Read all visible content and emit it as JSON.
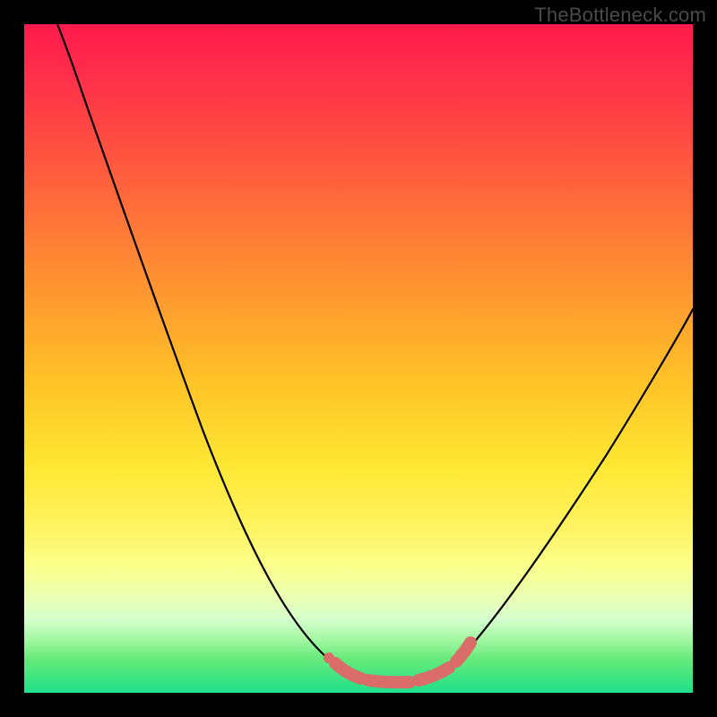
{
  "watermark": "TheBottleneck.com",
  "chart_data": {
    "type": "line",
    "title": "",
    "xlabel": "",
    "ylabel": "",
    "xlim": [
      0,
      100
    ],
    "ylim": [
      0,
      100
    ],
    "grid": false,
    "series": [
      {
        "name": "curve",
        "x": [
          5,
          8,
          12,
          16,
          20,
          24,
          28,
          32,
          36,
          40,
          44,
          48,
          51,
          53,
          56,
          59,
          62,
          65,
          68,
          72,
          76,
          80,
          84,
          88,
          92,
          96,
          100
        ],
        "y": [
          100,
          92,
          83,
          74,
          66,
          57,
          48,
          40,
          32,
          24,
          16,
          9,
          5,
          3,
          2,
          2,
          2,
          3,
          6,
          12,
          19,
          27,
          35,
          43,
          50,
          57,
          64
        ]
      },
      {
        "name": "bottom-highlight",
        "x": [
          48,
          50,
          52,
          54,
          56,
          58,
          60,
          62,
          64
        ],
        "y": [
          4.5,
          3,
          2.3,
          2.1,
          2.1,
          2.2,
          2.5,
          3.3,
          5
        ]
      }
    ],
    "colors": {
      "curve": "#000000",
      "highlight": "#da6d6a",
      "gradient_top": "#ff1a4d",
      "gradient_mid": "#ffe733",
      "gradient_bottom": "#1ee08b"
    }
  }
}
